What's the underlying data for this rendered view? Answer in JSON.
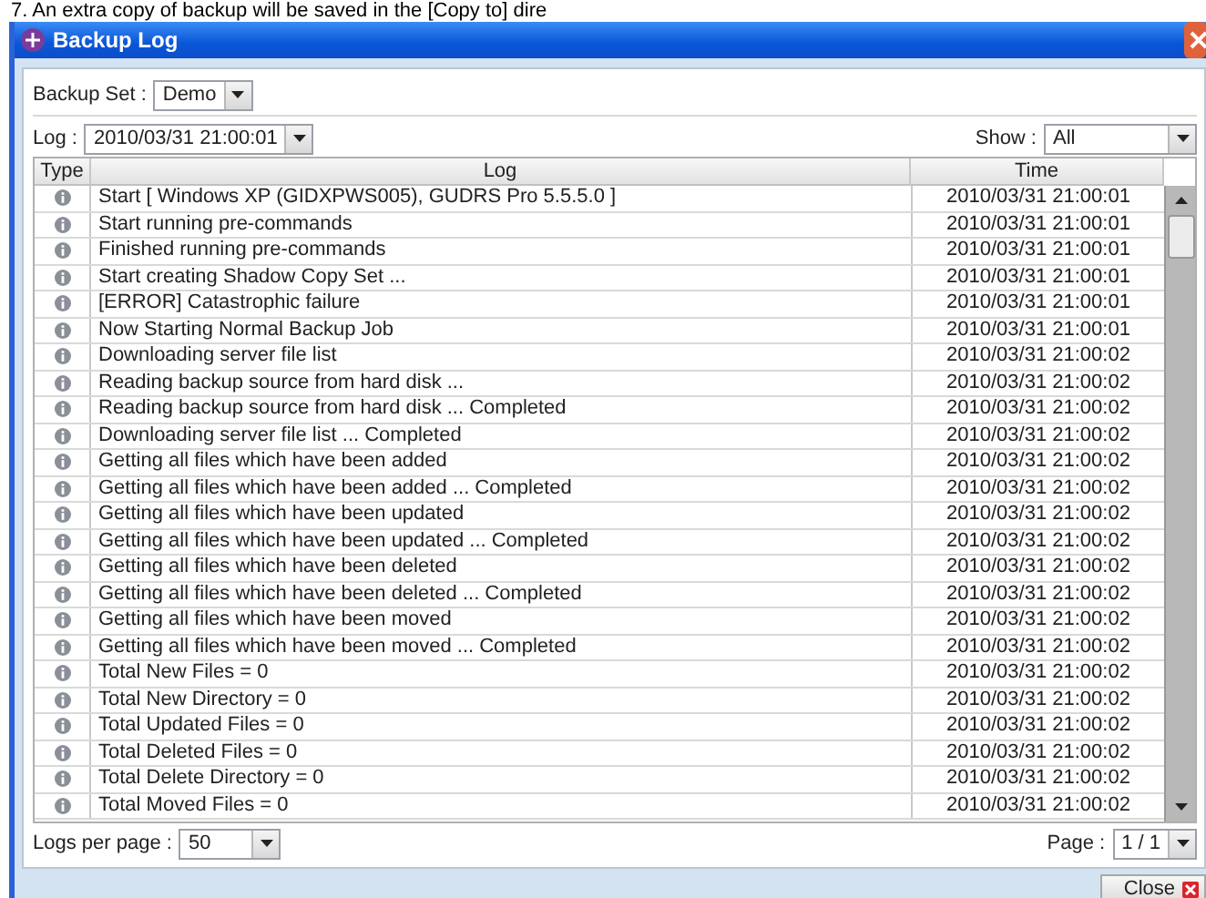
{
  "background_text": "7.     An extra copy of backup will be saved in the [Copy to] dire",
  "window": {
    "title": "Backup Log"
  },
  "backup_set": {
    "label": "Backup Set :",
    "value": "Demo"
  },
  "log_select": {
    "label": "Log :",
    "value": "2010/03/31 21:00:01"
  },
  "show": {
    "label": "Show :",
    "value": "All"
  },
  "table": {
    "columns": [
      "Type",
      "Log",
      "Time"
    ],
    "rows": [
      {
        "kind": "info",
        "log": "Start [ Windows XP (GIDXPWS005), GUDRS Pro 5.5.5.0 ]",
        "time": "2010/03/31 21:00:01"
      },
      {
        "kind": "info",
        "log": "Start running pre-commands",
        "time": "2010/03/31 21:00:01"
      },
      {
        "kind": "info",
        "log": "Finished running pre-commands",
        "time": "2010/03/31 21:00:01"
      },
      {
        "kind": "info",
        "log": "Start creating Shadow Copy Set ...",
        "time": "2010/03/31 21:00:01"
      },
      {
        "kind": "info",
        "log": "[ERROR] Catastrophic failure",
        "time": "2010/03/31 21:00:01"
      },
      {
        "kind": "info",
        "log": "Now Starting Normal Backup Job",
        "time": "2010/03/31 21:00:01"
      },
      {
        "kind": "info",
        "log": "Downloading server file list",
        "time": "2010/03/31 21:00:02"
      },
      {
        "kind": "info",
        "log": "Reading backup source from hard disk ...",
        "time": "2010/03/31 21:00:02"
      },
      {
        "kind": "info",
        "log": "Reading backup source from hard disk ... Completed",
        "time": "2010/03/31 21:00:02"
      },
      {
        "kind": "info",
        "log": "Downloading server file list ... Completed",
        "time": "2010/03/31 21:00:02"
      },
      {
        "kind": "info",
        "log": "Getting all files which have been added",
        "time": "2010/03/31 21:00:02"
      },
      {
        "kind": "info",
        "log": "Getting all files which have been added ... Completed",
        "time": "2010/03/31 21:00:02"
      },
      {
        "kind": "info",
        "log": "Getting all files which have been updated",
        "time": "2010/03/31 21:00:02"
      },
      {
        "kind": "info",
        "log": "Getting all files which have been updated ... Completed",
        "time": "2010/03/31 21:00:02"
      },
      {
        "kind": "info",
        "log": "Getting all files which have been deleted",
        "time": "2010/03/31 21:00:02"
      },
      {
        "kind": "info",
        "log": "Getting all files which have been deleted ... Completed",
        "time": "2010/03/31 21:00:02"
      },
      {
        "kind": "info",
        "log": "Getting all files which have been moved",
        "time": "2010/03/31 21:00:02"
      },
      {
        "kind": "info",
        "log": "Getting all files which have been moved ... Completed",
        "time": "2010/03/31 21:00:02"
      },
      {
        "kind": "info",
        "log": "Total New Files = 0",
        "time": "2010/03/31 21:00:02"
      },
      {
        "kind": "info",
        "log": "Total New Directory = 0",
        "time": "2010/03/31 21:00:02"
      },
      {
        "kind": "info",
        "log": "Total Updated Files = 0",
        "time": "2010/03/31 21:00:02"
      },
      {
        "kind": "info",
        "log": "Total Deleted Files = 0",
        "time": "2010/03/31 21:00:02"
      },
      {
        "kind": "info",
        "log": "Total Delete Directory = 0",
        "time": "2010/03/31 21:00:02"
      },
      {
        "kind": "info",
        "log": "Total Moved Files = 0",
        "time": "2010/03/31 21:00:02"
      }
    ]
  },
  "logs_per_page": {
    "label": "Logs per page :",
    "value": "50"
  },
  "page": {
    "label": "Page :",
    "value": "1 / 1"
  },
  "buttons": [
    {
      "label": "Close"
    }
  ]
}
